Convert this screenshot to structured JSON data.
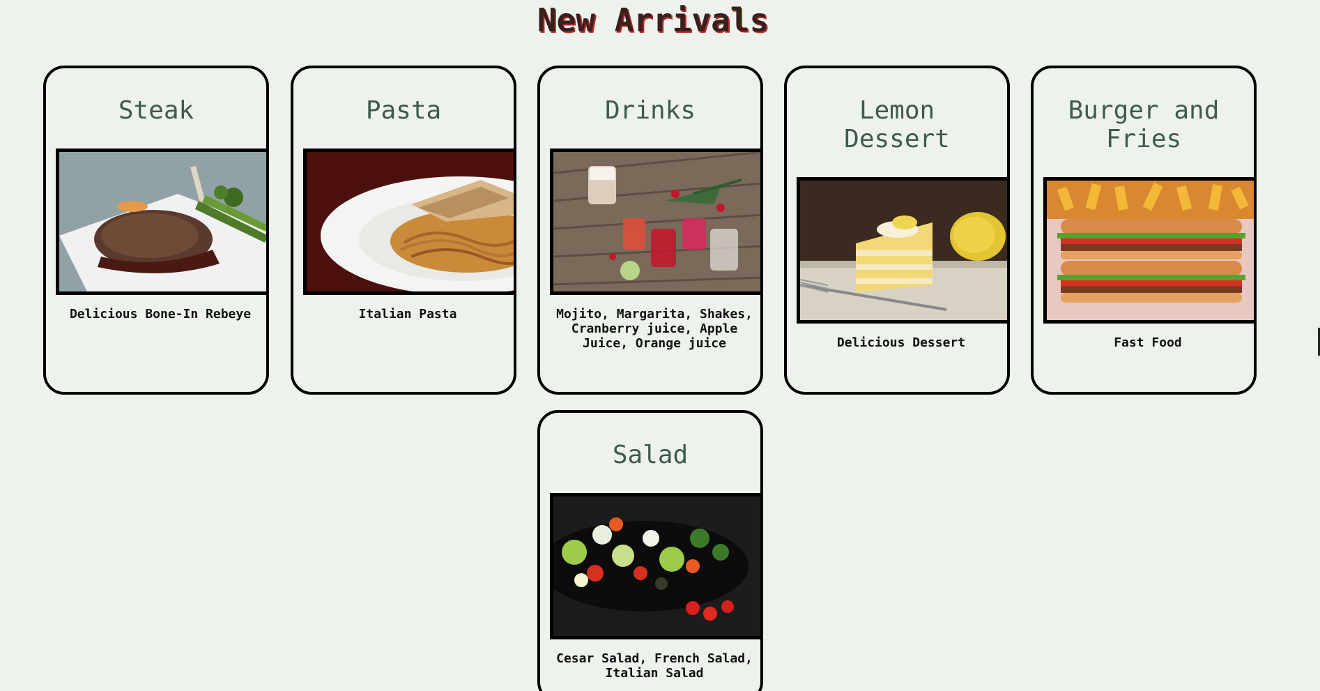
{
  "page": {
    "title": "New Arrivals"
  },
  "cards": [
    {
      "title": "Steak",
      "description": "Delicious Bone-In Rebeye",
      "image": "steak-photo"
    },
    {
      "title": "Pasta",
      "description": "Italian Pasta",
      "image": "pasta-photo"
    },
    {
      "title": "Drinks",
      "description": "Mojito, Margarita, Shakes, Cranberry juice, Apple Juice, Orange juice",
      "image": "drinks-photo"
    },
    {
      "title": "Lemon Dessert",
      "description": "Delicious Dessert",
      "image": "lemon-cake-photo"
    },
    {
      "title": "Burger and Fries",
      "description": "Fast Food",
      "image": "burger-photo"
    },
    {
      "title": "Salad",
      "description": "Cesar Salad, French Salad, Italian Salad",
      "image": "salad-photo"
    }
  ],
  "colors": {
    "background": "#edf3ec",
    "card_title": "#3f5a4f",
    "heading": "#3a1f1f",
    "heading_shadow": "#b52a2a"
  }
}
